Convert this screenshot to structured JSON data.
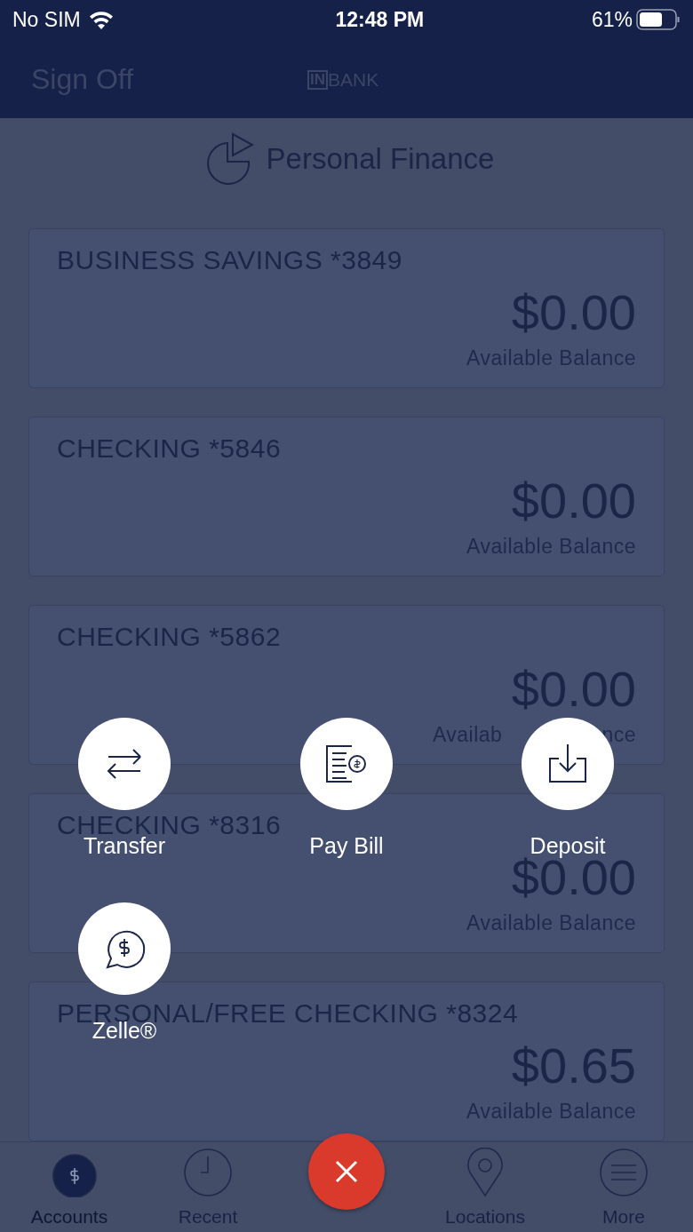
{
  "status_bar": {
    "carrier": "No SIM",
    "time": "12:48 PM",
    "battery": "61%"
  },
  "nav": {
    "left": "Sign Off",
    "logo_mark": "IN",
    "logo_text": "BANK"
  },
  "section_title": "Personal Finance",
  "accounts": [
    {
      "name": "BUSINESS SAVINGS *3849",
      "balance": "$0.00",
      "label": "Available Balance"
    },
    {
      "name": "CHECKING *5846",
      "balance": "$0.00",
      "label": "Available Balance"
    },
    {
      "name": "CHECKING *5862",
      "balance": "$0.00",
      "label_parts": [
        "Availab",
        "nce"
      ]
    },
    {
      "name": "CHECKING *8316",
      "balance": "$0.00",
      "label": "Available Balance"
    },
    {
      "name": "PERSONAL/FREE CHECKING *8324",
      "balance": "$0.65",
      "label": "Available Balance"
    }
  ],
  "quick_actions": [
    {
      "kind": "transfer",
      "label": "Transfer"
    },
    {
      "kind": "bill",
      "label": "Pay Bill"
    },
    {
      "kind": "deposit",
      "label": "Deposit"
    },
    {
      "kind": "zelle",
      "label": "Zelle®"
    }
  ],
  "tab_bar": [
    {
      "kind": "accounts",
      "label": "Accounts",
      "selected": true
    },
    {
      "kind": "recent",
      "label": "Recent",
      "selected": false
    },
    {
      "kind": "close"
    },
    {
      "kind": "locations",
      "label": "Locations",
      "selected": false
    },
    {
      "kind": "more",
      "label": "More",
      "selected": false
    }
  ]
}
